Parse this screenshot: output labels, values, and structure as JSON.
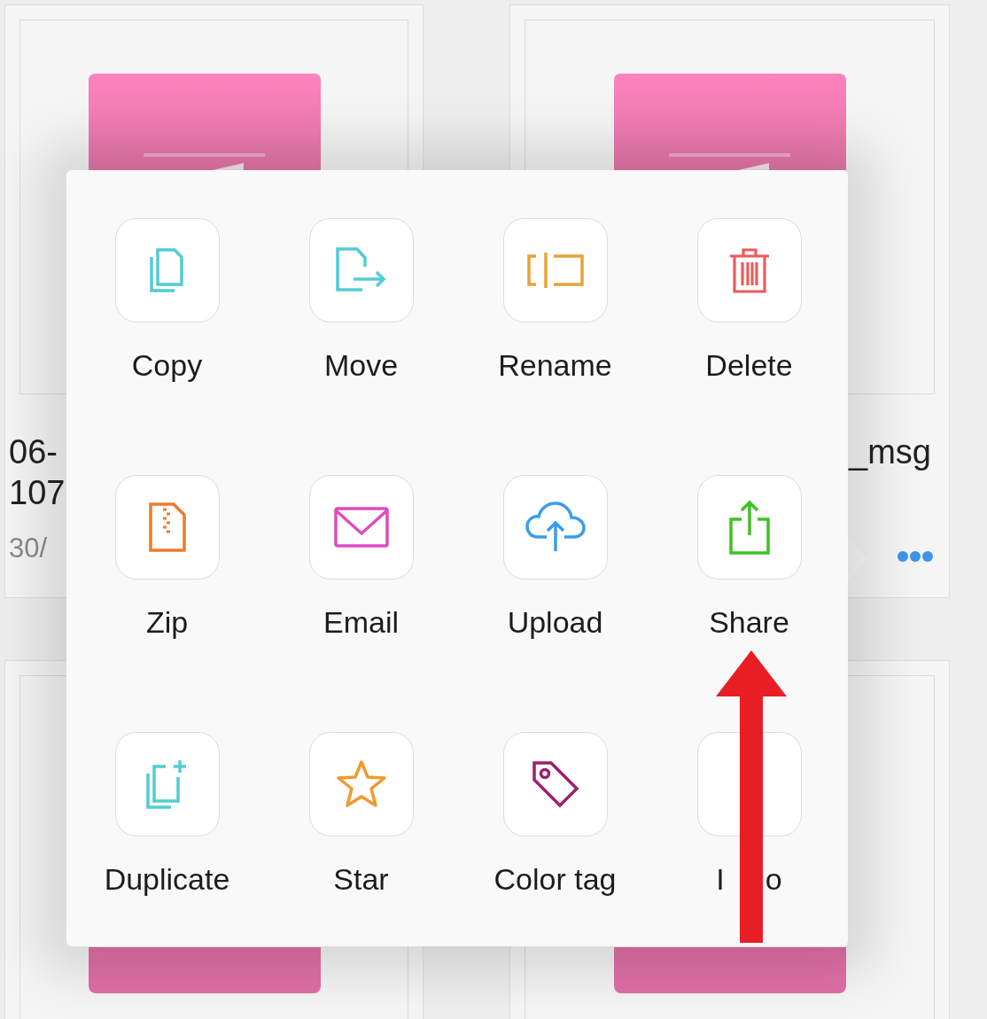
{
  "cards": [
    {
      "title_lines": [
        "06-",
        "107"
      ],
      "date": "30/"
    },
    {
      "title_lines": [
        "_msg"
      ],
      "more_button": true
    }
  ],
  "menu": {
    "actions": [
      {
        "label": "Copy",
        "kind": "copy"
      },
      {
        "label": "Move",
        "kind": "move"
      },
      {
        "label": "Rename",
        "kind": "rename"
      },
      {
        "label": "Delete",
        "kind": "delete"
      },
      {
        "label": "Zip",
        "kind": "zip"
      },
      {
        "label": "Email",
        "kind": "email"
      },
      {
        "label": "Upload",
        "kind": "upload"
      },
      {
        "label": "Share",
        "kind": "share"
      },
      {
        "label": "Duplicate",
        "kind": "duplicate"
      },
      {
        "label": "Star",
        "kind": "star"
      },
      {
        "label": "Color tag",
        "kind": "tag"
      },
      {
        "label": "I",
        "label_tail": "o",
        "kind": "info"
      }
    ]
  },
  "annotation": {
    "kind": "arrow"
  }
}
